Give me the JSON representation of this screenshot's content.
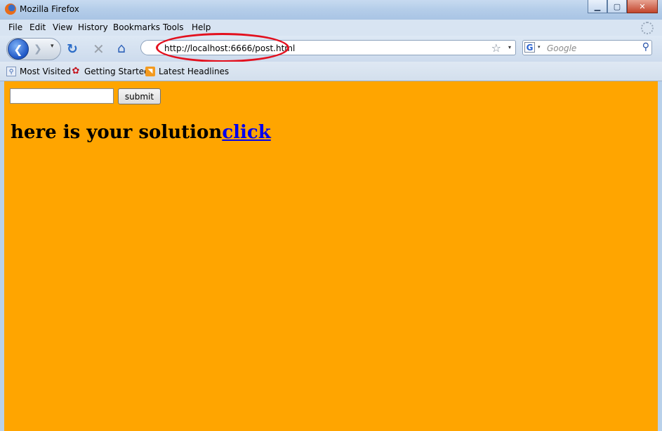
{
  "window": {
    "title": "Mozilla Firefox",
    "controls": {
      "minimize": "▁",
      "maximize": "▢",
      "close": "✕"
    }
  },
  "menubar": {
    "items": [
      "File",
      "Edit",
      "View",
      "History",
      "Bookmarks",
      "Tools",
      "Help"
    ]
  },
  "navbar": {
    "back_glyph": "❮",
    "forward_glyph": "❯",
    "dropdown_glyph": "▾",
    "reload_glyph": "↻",
    "stop_glyph": "✕",
    "home_glyph": "⌂",
    "url": "http://localhost:6666/post.html",
    "star_glyph": "☆",
    "search": {
      "engine_glyph": "G",
      "placeholder": "Google",
      "go_glyph": "⚲"
    }
  },
  "bookmarks": {
    "items": [
      {
        "label": "Most Visited",
        "icon": "most-visited-icon",
        "glyph": "⚲"
      },
      {
        "label": "Getting Started",
        "icon": "getting-started-icon",
        "glyph": "✿"
      },
      {
        "label": "Latest Headlines",
        "icon": "rss-icon",
        "glyph": "◥"
      }
    ]
  },
  "page": {
    "background_color": "#ffa500",
    "input_value": "",
    "submit_label": "submit",
    "heading_text": "here is your solution",
    "link_text": "click"
  },
  "annotation": {
    "color": "#e3101e"
  }
}
